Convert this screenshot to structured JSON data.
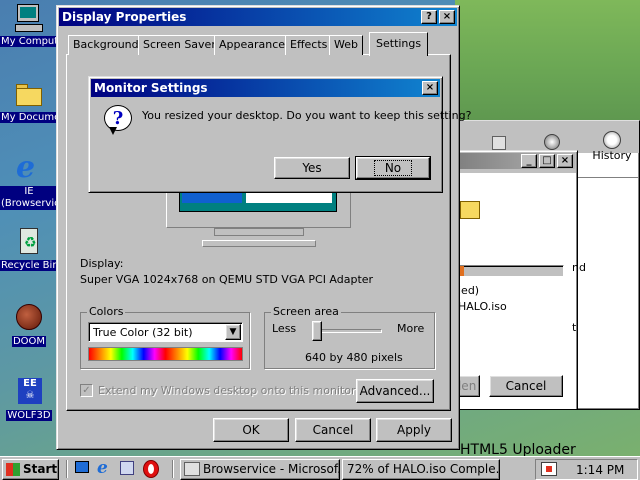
{
  "desktop": {
    "icons": [
      {
        "label": "My Computer"
      },
      {
        "label": "My Documents"
      },
      {
        "label": "IE (Browservice)"
      },
      {
        "label": "Recycle Bin"
      },
      {
        "label": "DOOM"
      },
      {
        "label": "WOLF3D"
      }
    ]
  },
  "bg_window": {
    "toolbar_history": "History",
    "text_and": "nd",
    "text_ied": "ied)",
    "text_file": "HALO.iso",
    "text_t": "t",
    "button_partial": "den",
    "cancel_label": "Cancel",
    "bottom_text": "HTML5 Uploader",
    "progress_fraction": 0.05
  },
  "display_properties": {
    "title": "Display Properties",
    "help_glyph": "?",
    "close_glyph": "×",
    "tabs": [
      "Background",
      "Screen Saver",
      "Appearance",
      "Effects",
      "Web",
      "Settings"
    ],
    "display_label": "Display:",
    "display_value": "Super VGA 1024x768 on QEMU STD VGA PCI Adapter",
    "colors_label": "Colors",
    "colors_value": "True Color (32 bit)",
    "screen_area_label": "Screen area",
    "less_label": "Less",
    "more_label": "More",
    "resolution_text": "640 by 480 pixels",
    "slider_level": 0.0,
    "extend_label": "Extend my Windows desktop onto this monitor",
    "advanced_label": "Advanced...",
    "ok_label": "OK",
    "cancel_label": "Cancel",
    "apply_label": "Apply"
  },
  "monitor_dialog": {
    "title": "Monitor Settings",
    "close_glyph": "×",
    "message": "You resized your desktop.  Do you want to keep this setting?",
    "yes_label": "Yes",
    "no_label": "No"
  },
  "taskbar": {
    "start_label": "Start",
    "tasks": [
      {
        "label": "Browservice - Microsof..."
      },
      {
        "label": "72% of HALO.iso Comple..."
      }
    ],
    "clock": "1:14 PM"
  },
  "colors": {
    "title_active": "#000080",
    "face": "#c0c0c0"
  }
}
